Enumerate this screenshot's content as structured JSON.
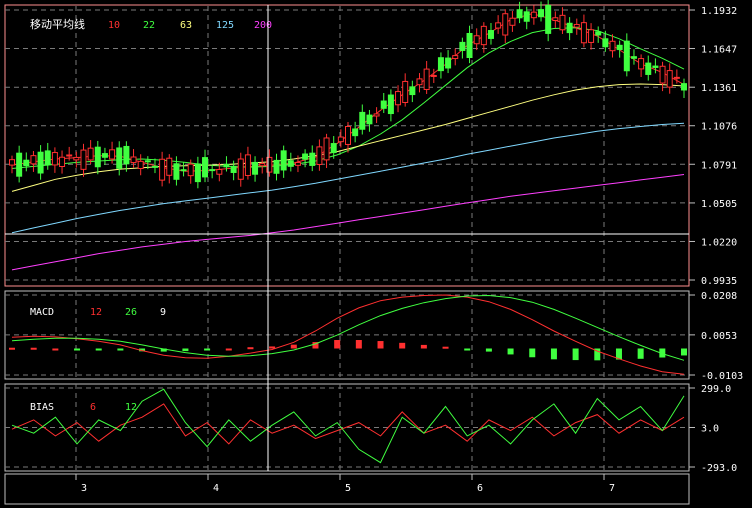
{
  "colors": {
    "background": "#000000",
    "frame": "#c0c0c0",
    "price_frame": "#ff9090",
    "grid": "#7a7a7a",
    "up": "#ff3030",
    "down": "#40ff40",
    "ma10": "#ff3030",
    "ma22": "#40ff40",
    "ma63": "#ffff80",
    "ma125": "#80d8ff",
    "ma200": "#ff40ff",
    "crosshair": "#ffffff",
    "text": "#ffffff"
  },
  "panels": {
    "price": {
      "title": "移动平均线",
      "legend": [
        {
          "label": "10",
          "color": "#ff3030"
        },
        {
          "label": "22",
          "color": "#40ff40"
        },
        {
          "label": "63",
          "color": "#ffff80"
        },
        {
          "label": "125",
          "color": "#80d8ff"
        },
        {
          "label": "200",
          "color": "#ff40ff"
        }
      ]
    },
    "macd": {
      "title": "MACD",
      "legend": [
        {
          "label": "12",
          "color": "#ff3030"
        },
        {
          "label": "26",
          "color": "#40ff40"
        },
        {
          "label": "9",
          "color": "#ffffff"
        }
      ]
    },
    "bias": {
      "title": "BIAS",
      "legend": [
        {
          "label": "6",
          "color": "#ff3030"
        },
        {
          "label": "12",
          "color": "#40ff40"
        }
      ]
    }
  },
  "chart_data": [
    {
      "type": "candlestick",
      "title": "移动平均线",
      "series": [
        {
          "name": "10",
          "values": [
            1.0785,
            1.081,
            1.083,
            1.084,
            1.0855,
            1.085,
            1.0805,
            1.0765,
            1.074,
            1.0745,
            1.076,
            1.0775,
            1.0785,
            1.08,
            1.0845,
            1.0945,
            1.1065,
            1.119,
            1.1305,
            1.141,
            1.153,
            1.167,
            1.176,
            1.186,
            1.1905,
            1.186,
            1.18,
            1.174,
            1.164,
            1.1535,
            1.147,
            1.138
          ]
        },
        {
          "name": "22",
          "values": [
            1.076,
            1.0775,
            1.079,
            1.0805,
            1.0815,
            1.0825,
            1.083,
            1.082,
            1.0805,
            1.0785,
            1.0775,
            1.077,
            1.0775,
            1.079,
            1.0815,
            1.086,
            1.0925,
            1.1015,
            1.112,
            1.1245,
            1.1375,
            1.1505,
            1.1615,
            1.17,
            1.1765,
            1.1795,
            1.18,
            1.178,
            1.172,
            1.1645,
            1.1575,
            1.1495
          ]
        },
        {
          "name": "63",
          "values": [
            1.059,
            1.0635,
            1.068,
            1.071,
            1.0735,
            1.0755,
            1.0765,
            1.0775,
            1.078,
            1.0785,
            1.079,
            1.08,
            1.081,
            1.083,
            1.0855,
            1.0885,
            1.0925,
            1.0965,
            1.1005,
            1.1045,
            1.1085,
            1.113,
            1.1175,
            1.122,
            1.1265,
            1.1305,
            1.134,
            1.1365,
            1.138,
            1.1385,
            1.138,
            1.137
          ]
        },
        {
          "name": "125",
          "values": [
            1.0285,
            1.032,
            1.0355,
            1.039,
            1.042,
            1.045,
            1.0475,
            1.05,
            1.052,
            1.054,
            1.056,
            1.058,
            1.06,
            1.0625,
            1.065,
            1.068,
            1.071,
            1.074,
            1.077,
            1.08,
            1.083,
            1.0865,
            1.0895,
            1.0925,
            1.0955,
            1.0985,
            1.101,
            1.1035,
            1.1055,
            1.107,
            1.1085,
            1.1095
          ]
        },
        {
          "name": "200",
          "values": [
            1.001,
            1.004,
            1.007,
            1.01,
            1.013,
            1.0155,
            1.018,
            1.02,
            1.022,
            1.0235,
            1.025,
            1.0265,
            1.0285,
            1.0305,
            1.033,
            1.0355,
            1.038,
            1.0405,
            1.043,
            1.0455,
            1.048,
            1.0505,
            1.053,
            1.0555,
            1.0575,
            1.0595,
            1.0615,
            1.0635,
            1.0655,
            1.0675,
            1.0695,
            1.0715
          ]
        }
      ],
      "x_tick_labels": [
        "3",
        "4",
        "5",
        "6",
        "7"
      ],
      "y_tick_labels": [
        "1.1932",
        "1.1647",
        "1.1361",
        "1.1076",
        "1.0791",
        "1.0505",
        "1.0220",
        "0.9935"
      ],
      "ylim": [
        0.9935,
        1.1932
      ],
      "grid": true
    },
    {
      "type": "line",
      "title": "MACD",
      "series": [
        {
          "name": "12",
          "values": [
            0.0044,
            0.0048,
            0.0045,
            0.0038,
            0.0028,
            0.0014,
            -0.0008,
            -0.0026,
            -0.0036,
            -0.0038,
            -0.003,
            -0.0018,
            -0.0004,
            0.0024,
            0.0068,
            0.0118,
            0.0158,
            0.0186,
            0.02,
            0.0206,
            0.0208,
            0.02,
            0.0182,
            0.0152,
            0.0112,
            0.0068,
            0.0028,
            -0.001,
            -0.004,
            -0.0068,
            -0.009,
            -0.01
          ]
        },
        {
          "name": "26",
          "values": [
            0.003,
            0.0036,
            0.004,
            0.004,
            0.0036,
            0.0028,
            0.0014,
            -0.0002,
            -0.0016,
            -0.0026,
            -0.003,
            -0.0028,
            -0.002,
            -0.0006,
            0.0018,
            0.0052,
            0.0092,
            0.0128,
            0.0156,
            0.0178,
            0.0194,
            0.0204,
            0.0206,
            0.0198,
            0.018,
            0.0152,
            0.0118,
            0.0082,
            0.0046,
            0.0012,
            -0.002,
            -0.0046
          ]
        },
        {
          "name": "9",
          "values": [
            0.0003,
            0.0003,
            0.0,
            -0.0003,
            -0.0004,
            -0.0007,
            -0.0011,
            -0.0012,
            -0.001,
            -0.0006,
            0.0,
            0.0005,
            0.0008,
            0.0015,
            0.0025,
            0.0033,
            0.0033,
            0.0029,
            0.0022,
            0.0014,
            0.0007,
            -0.0002,
            -0.0012,
            -0.0023,
            -0.0034,
            -0.0042,
            -0.0045,
            -0.0046,
            -0.0043,
            -0.004,
            -0.0035,
            -0.0027
          ]
        }
      ],
      "y_tick_labels": [
        "0.0208",
        "0.0053",
        "-0.0103"
      ],
      "ylim": [
        -0.0103,
        0.0208
      ],
      "grid": true
    },
    {
      "type": "line",
      "title": "BIAS",
      "series": [
        {
          "name": "6",
          "values": [
            -10,
            60,
            -60,
            40,
            -100,
            20,
            80,
            180,
            -60,
            40,
            -120,
            60,
            -40,
            20,
            -80,
            -20,
            40,
            -60,
            120,
            -40,
            20,
            -100,
            60,
            -20,
            80,
            -60,
            40,
            100,
            -40,
            60,
            -20,
            80
          ]
        },
        {
          "name": "12",
          "values": [
            20,
            -40,
            80,
            -120,
            60,
            -20,
            200,
            290,
            40,
            -140,
            60,
            -100,
            20,
            120,
            -60,
            40,
            -160,
            -260,
            80,
            -40,
            160,
            -60,
            20,
            -120,
            60,
            180,
            -40,
            220,
            60,
            160,
            -20,
            240
          ]
        }
      ],
      "y_tick_labels": [
        "299.0",
        "3.0",
        "-293.0"
      ],
      "ylim": [
        -293.0,
        299.0
      ],
      "grid": true
    }
  ]
}
